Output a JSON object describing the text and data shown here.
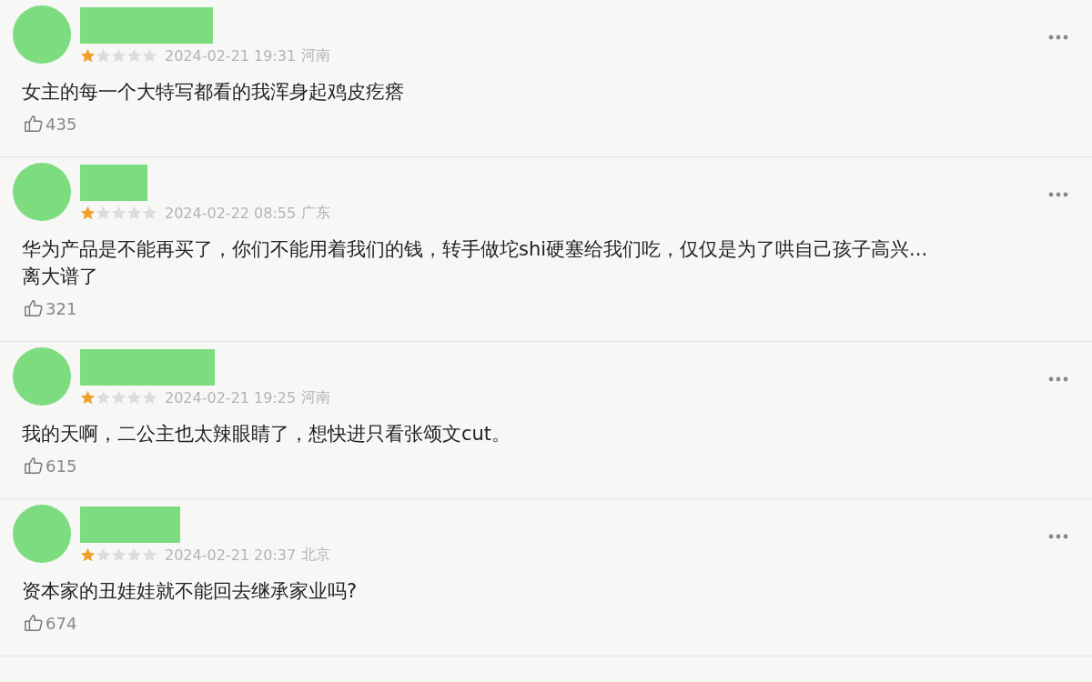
{
  "comments": [
    {
      "stars": 1,
      "time": "2024-02-21 19:31",
      "location": "河南",
      "lines": [
        "女主的每一个大特写都看的我浑身起鸡皮疙瘩"
      ],
      "likes": "435"
    },
    {
      "stars": 1,
      "time": "2024-02-22 08:55",
      "location": "广东",
      "lines": [
        "华为产品是不能再买了，你们不能用着我们的钱，转手做坨shi硬塞给我们吃，仅仅是为了哄自己孩子高兴...",
        "离大谱了"
      ],
      "likes": "321"
    },
    {
      "stars": 1,
      "time": "2024-02-21 19:25",
      "location": "河南",
      "lines": [
        "我的天啊，二公主也太辣眼睛了，想快进只看张颂文cut。"
      ],
      "likes": "615"
    },
    {
      "stars": 1,
      "time": "2024-02-21 20:37",
      "location": "北京",
      "lines": [
        "资本家的丑娃娃就不能回去继承家业吗?"
      ],
      "likes": "674"
    }
  ]
}
